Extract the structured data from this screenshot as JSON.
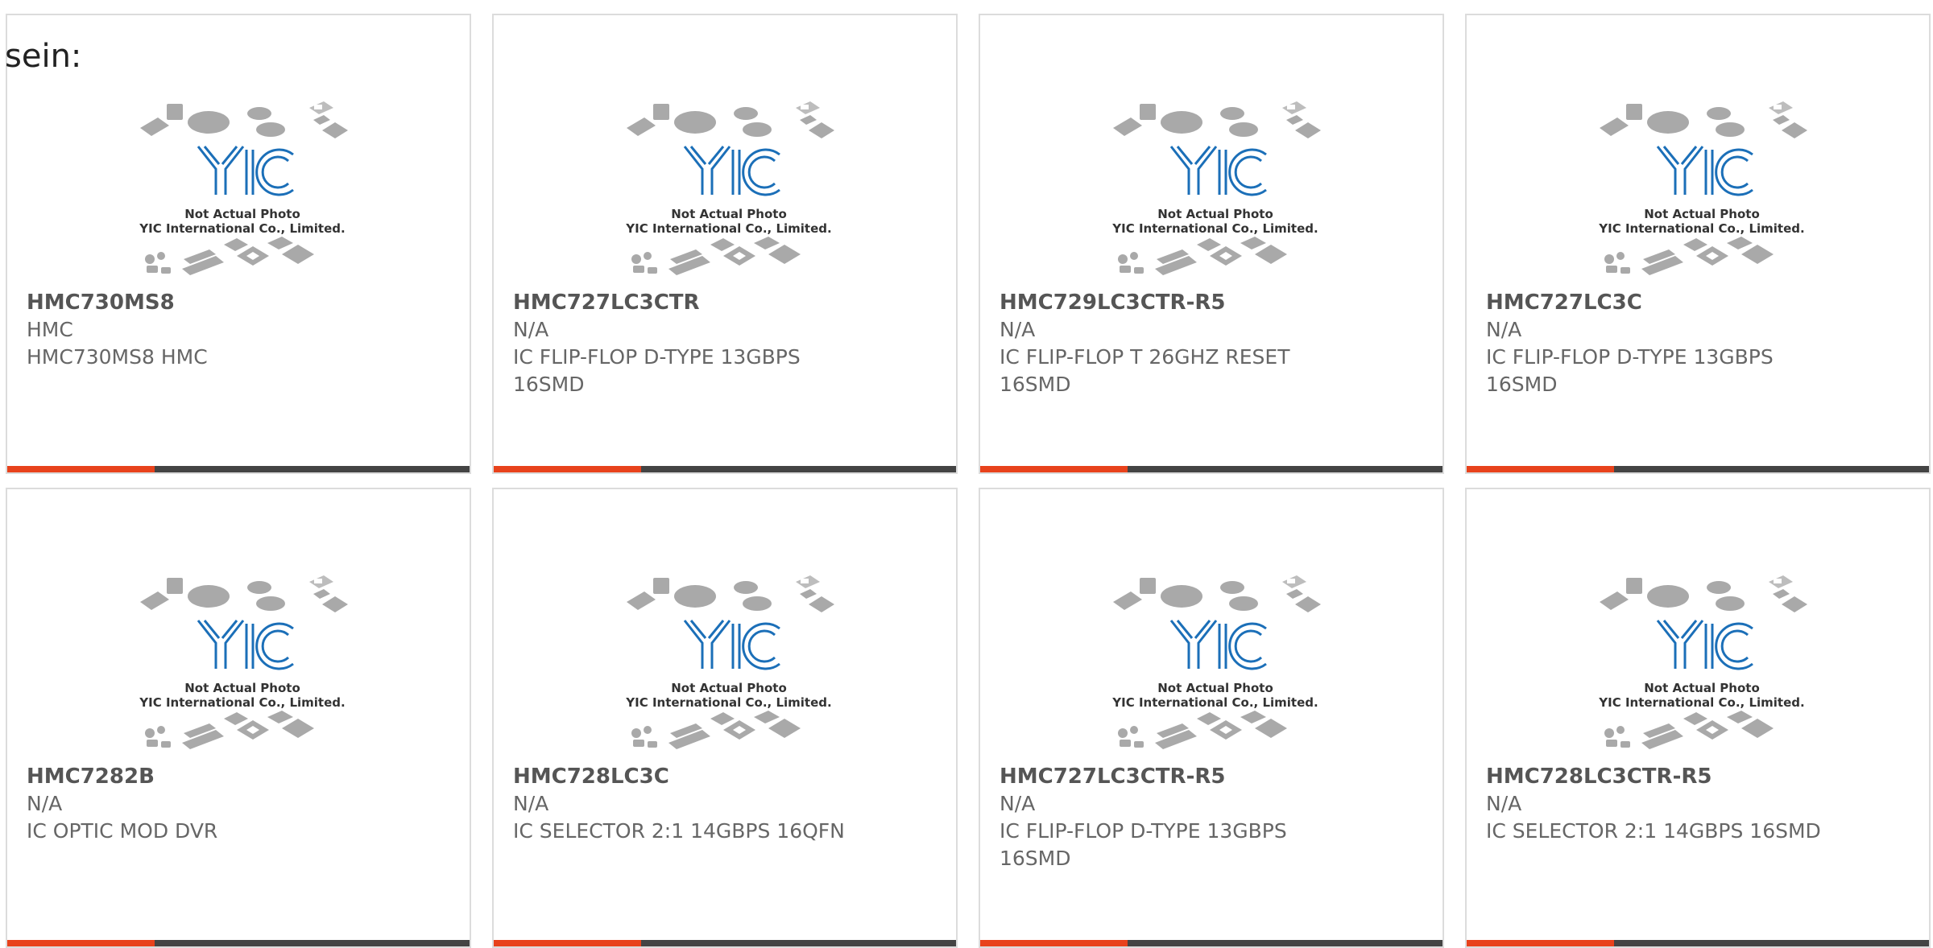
{
  "overlay_text": "sein:",
  "colors": {
    "accent": "#e8421c",
    "bar": "#444444",
    "logo": "#1b6fb8"
  },
  "photo_placeholder": {
    "line1": "Not Actual Photo",
    "line2": "YIC International Co., Limited."
  },
  "products": [
    {
      "part_number": "HMC730MS8",
      "manufacturer": "HMC",
      "description": "HMC730MS8 HMC"
    },
    {
      "part_number": "HMC727LC3CTR",
      "manufacturer": "N/A",
      "description": "IC FLIP-FLOP D-TYPE 13GBPS 16SMD"
    },
    {
      "part_number": "HMC729LC3CTR-R5",
      "manufacturer": "N/A",
      "description": "IC FLIP-FLOP T 26GHZ RESET 16SMD"
    },
    {
      "part_number": "HMC727LC3C",
      "manufacturer": "N/A",
      "description": "IC FLIP-FLOP D-TYPE 13GBPS 16SMD"
    },
    {
      "part_number": "HMC7282B",
      "manufacturer": "N/A",
      "description": "IC OPTIC MOD DVR"
    },
    {
      "part_number": "HMC728LC3C",
      "manufacturer": "N/A",
      "description": "IC SELECTOR 2:1 14GBPS 16QFN"
    },
    {
      "part_number": "HMC727LC3CTR-R5",
      "manufacturer": "N/A",
      "description": "IC FLIP-FLOP D-TYPE 13GBPS 16SMD"
    },
    {
      "part_number": "HMC728LC3CTR-R5",
      "manufacturer": "N/A",
      "description": "IC SELECTOR 2:1 14GBPS 16SMD"
    }
  ]
}
